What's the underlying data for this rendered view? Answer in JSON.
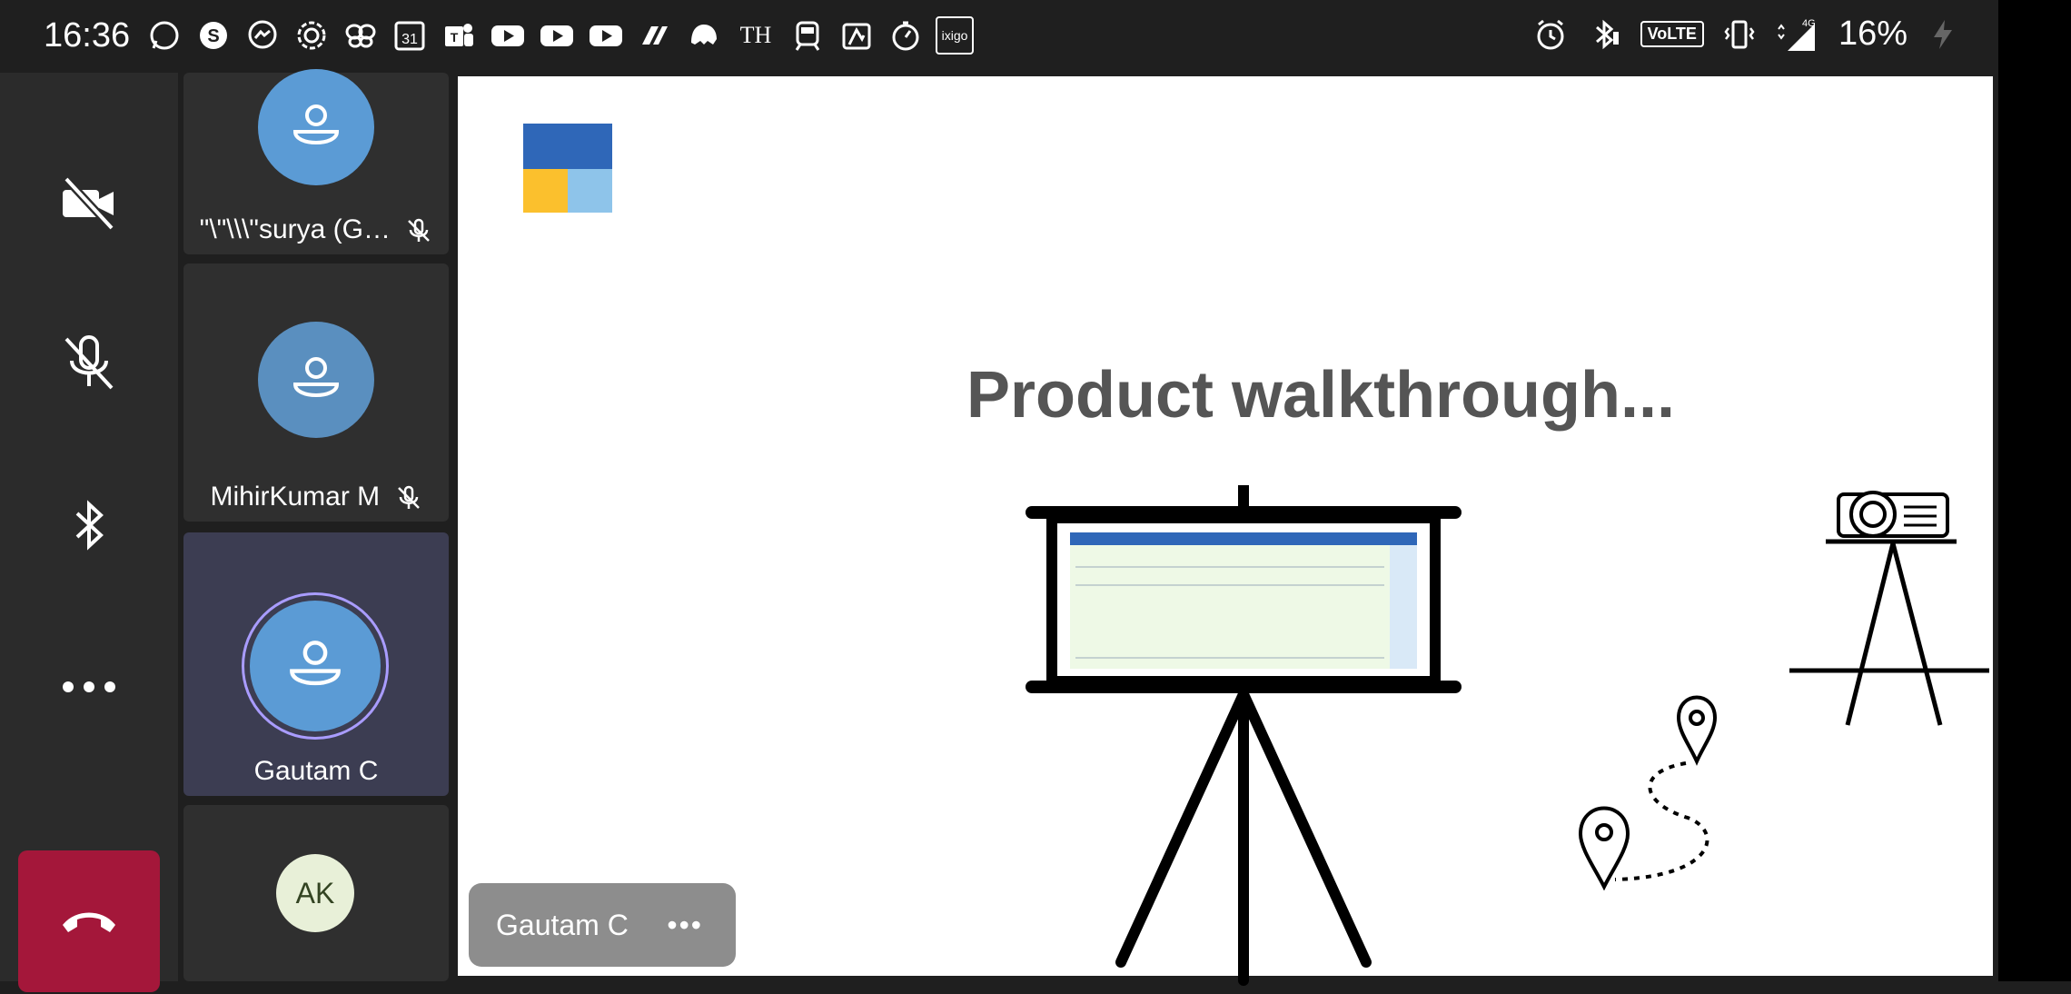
{
  "status_bar": {
    "time": "16:36",
    "calendar_day": "31",
    "th_label": "TH",
    "ixigo_label": "ixigo",
    "volte_label": "VoLTE",
    "network_label": "4G",
    "battery": "16%",
    "icons": [
      "whatsapp-icon",
      "skype-icon",
      "messenger-icon",
      "signal-app-icon",
      "butterfly-icon",
      "calendar-icon",
      "teams-icon",
      "youtube-icon",
      "youtube-icon",
      "youtube-icon",
      "app-icon",
      "app-icon",
      "th-icon",
      "train-icon",
      "app-icon",
      "timer-icon",
      "ixigo-icon",
      "alarm-icon",
      "bluetooth-icon",
      "volte-icon",
      "vibrate-icon",
      "signal-icon",
      "battery-icon"
    ]
  },
  "controls": {
    "camera": "camera-off-icon",
    "mic": "mic-off-icon",
    "audio": "bluetooth-icon",
    "more": "more-icon",
    "hangup": "hang-up-icon"
  },
  "participants": [
    {
      "name": "\"\\\"\\\\\\\"surya (G…",
      "muted": true
    },
    {
      "name": "MihirKumar M",
      "muted": true
    },
    {
      "name": "Gautam C",
      "muted": false,
      "active": true
    },
    {
      "initials": "AK"
    }
  ],
  "stage": {
    "slide_title": "Product walkthrough...",
    "presenter_chip": "Gautam C",
    "chip_more": "•••"
  },
  "colors": {
    "hangup": "#a4173a",
    "avatar": "#5b9bd5",
    "active_tile": "#3c3d52",
    "active_ring": "#a99cff"
  }
}
